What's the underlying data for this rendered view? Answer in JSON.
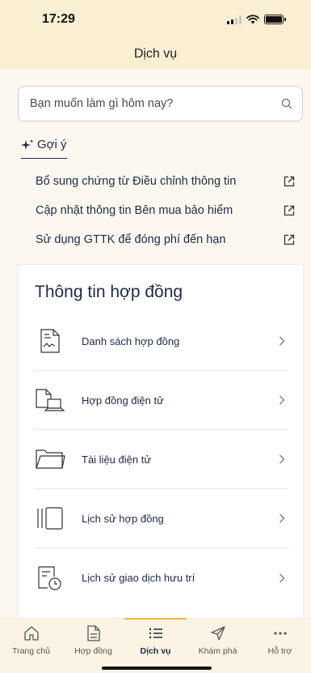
{
  "status": {
    "time": "17:29"
  },
  "header": {
    "title": "Dịch vụ"
  },
  "search": {
    "placeholder": "Bạn muốn làm gì hôm nay?"
  },
  "suggestions": {
    "heading": "Gợi ý",
    "items": [
      {
        "label": "Bổ sung chứng từ Điều chỉnh thông tin"
      },
      {
        "label": "Cập nhật thông tin Bên mua bảo hiểm"
      },
      {
        "label": "Sử dụng GTTK để đóng phí đến hạn"
      }
    ]
  },
  "contract_card": {
    "title": "Thông tin hợp đồng",
    "items": [
      {
        "label": "Danh sách hợp đồng",
        "icon": "contract-list-icon"
      },
      {
        "label": "Hợp đồng điện tử",
        "icon": "laptop-document-icon"
      },
      {
        "label": "Tài liệu điện tử",
        "icon": "folder-icon"
      },
      {
        "label": "Lịch sử hợp đồng",
        "icon": "history-cards-icon"
      },
      {
        "label": "Lịch sử giao dịch hưu trí",
        "icon": "document-clock-icon"
      }
    ]
  },
  "tabbar": {
    "tabs": [
      {
        "label": "Trang chủ",
        "icon": "home-icon"
      },
      {
        "label": "Hợp đồng",
        "icon": "document-icon"
      },
      {
        "label": "Dịch vụ",
        "icon": "list-icon",
        "active": true
      },
      {
        "label": "Khám phá",
        "icon": "send-icon"
      },
      {
        "label": "Hỗ trợ",
        "icon": "more-icon"
      }
    ]
  },
  "colors": {
    "accent": "#f4b83b",
    "text_primary": "#1e2a4a",
    "background": "#fbf3e4"
  }
}
